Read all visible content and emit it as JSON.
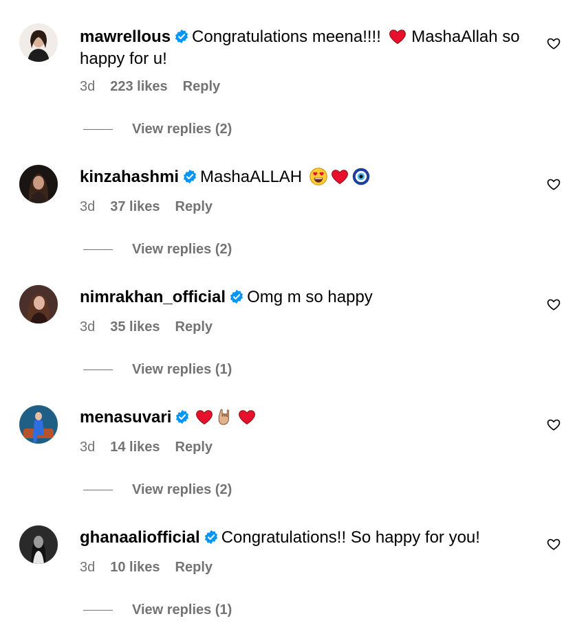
{
  "comments": [
    {
      "username": "mawrellous",
      "text_before": "Congratulations meena!!!!",
      "emoji_mid": "red-heart",
      "text_after": "MashaAllah so happy for u!",
      "emojis_end": [],
      "age": "3d",
      "likes": "223 likes",
      "reply": "Reply",
      "view_replies": "View replies (2)"
    },
    {
      "username": "kinzahashmi",
      "text_before": "MashaALLAH",
      "emoji_mid": "",
      "text_after": "",
      "emojis_end": [
        "heart-eyes",
        "red-heart",
        "nazar-amulet"
      ],
      "age": "3d",
      "likes": "37 likes",
      "reply": "Reply",
      "view_replies": "View replies (2)"
    },
    {
      "username": "nimrakhan_official",
      "text_before": "Omg m so happy",
      "emoji_mid": "",
      "text_after": "",
      "emojis_end": [],
      "age": "3d",
      "likes": "35 likes",
      "reply": "Reply",
      "view_replies": "View replies (1)"
    },
    {
      "username": "menasuvari",
      "text_before": "",
      "emoji_mid": "",
      "text_after": "",
      "emojis_end": [
        "red-heart",
        "sign-of-horns",
        "red-heart"
      ],
      "age": "3d",
      "likes": "14 likes",
      "reply": "Reply",
      "view_replies": "View replies (2)"
    },
    {
      "username": "ghanaaliofficial",
      "text_before": "Congratulations!! So happy for you!",
      "emoji_mid": "",
      "text_after": "",
      "emojis_end": [],
      "age": "3d",
      "likes": "10 likes",
      "reply": "Reply",
      "view_replies": "View replies (1)"
    }
  ],
  "colors": {
    "text": "#000000",
    "secondary": "#737373",
    "verified": "#0095f6",
    "heart": "#e0245e"
  },
  "icons": {
    "verified": "verified-badge-icon",
    "like": "heart-outline-icon"
  }
}
